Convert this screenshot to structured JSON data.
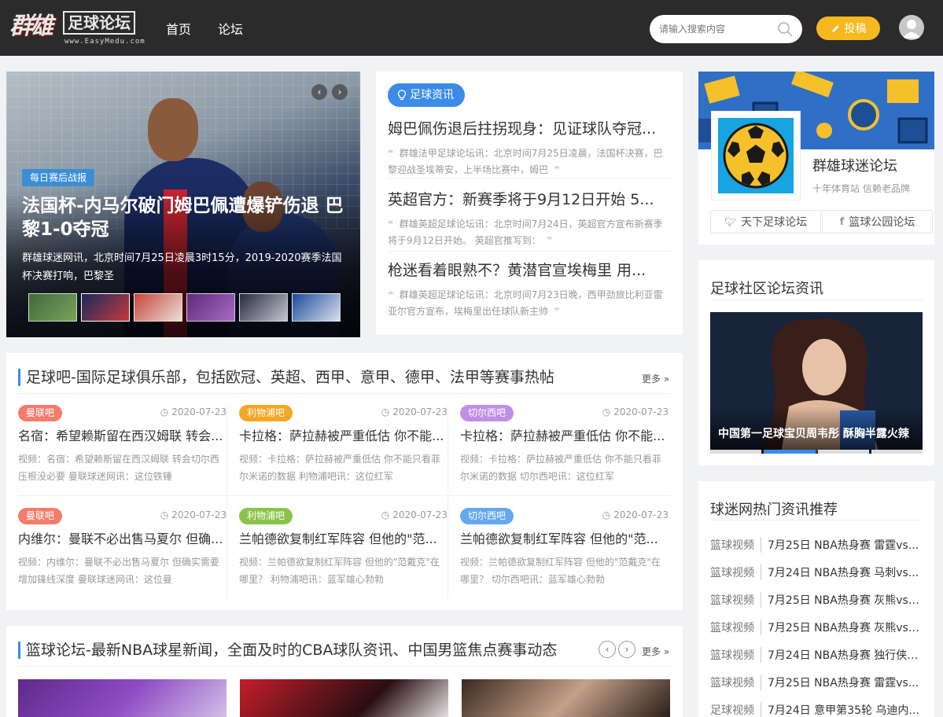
{
  "header": {
    "logo_main": "群雄",
    "logo_box": "足球论坛",
    "logo_url": "www.EasyMedu.com",
    "nav": [
      "首页",
      "论坛"
    ],
    "search_placeholder": "请输入搜索内容",
    "post_label": "投稿",
    "colors": {
      "bg": "#2b2b2b",
      "post_button": "#f6b81e"
    }
  },
  "slider": {
    "tag": "每日赛后战报",
    "title": "法国杯-内马尔破门姆巴佩遭爆铲伤退 巴黎1-0夺冠",
    "desc": "群雄球迷网讯，北京时间7月25日凌晨3时15分，2019-2020赛季法国杯决赛打响，巴黎圣",
    "prev_icon": "chevron-left-icon",
    "next_icon": "chevron-right-icon"
  },
  "news": {
    "tag": "足球资讯",
    "items": [
      {
        "title": "姆巴佩伤退后拄拐现身：见证球队夺冠...",
        "excerpt": "群雄法甲足球论坛讯：北京时间7月25日凌晨，法国杯决赛，巴黎迎战圣埃蒂安，上半场比赛中，姆巴"
      },
      {
        "title": "英超官方：新赛季将于9月12日开始 5...",
        "excerpt": "群雄英超足球论坛讯：北京时间7月24日，英超官方宣布新赛季将于9月12日开始。 英超官推写到："
      },
      {
        "title": "枪迷看着眼熟不？黄潜官宣埃梅里 用...",
        "excerpt": "群雄英超足球论坛讯：北京时间7月23日晚，西甲劲旅比利亚雷亚尔官方宣布，埃梅里出任球队新主帅"
      }
    ]
  },
  "football_section": {
    "title": "足球吧-国际足球俱乐部，包括欧冠、英超、西甲、意甲、德甲、法甲等赛事热帖",
    "more": "更多 »",
    "posts": [
      {
        "badge": "曼联吧",
        "badge_color": "#f47c6b",
        "date": "2020-07-23",
        "title": "名宿：希望赖斯留在西汉姆联 转会...",
        "excerpt": "视频：名宿：希望赖斯留在西汉姆联 转会切尔西压根没必要 曼联球迷网讯：这位铁锤"
      },
      {
        "badge": "利物浦吧",
        "badge_color": "#f5a623",
        "date": "2020-07-23",
        "title": "卡拉格：萨拉赫被严重低估 你不能...",
        "excerpt": "视频：卡拉格：萨拉赫被严重低估 你不能只看菲尔米诺的数据 利物浦吧讯：这位红军"
      },
      {
        "badge": "切尔西吧",
        "badge_color": "#c08ee3",
        "date": "2020-07-23",
        "title": "卡拉格：萨拉赫被严重低估 你不能...",
        "excerpt": "视频：卡拉格：萨拉赫被严重低估 你不能只看菲尔米诺的数据 切尔西吧讯：这位红军"
      },
      {
        "badge": "曼联吧",
        "badge_color": "#f47c6b",
        "date": "2020-07-23",
        "title": "内维尔：曼联不必出售马夏尔 但确...",
        "excerpt": "视频：内维尔：曼联不必出售马夏尔 但确实需要增加锋线深度 曼联球迷网讯：这位曼"
      },
      {
        "badge": "利物浦吧",
        "badge_color": "#8bc34a",
        "date": "2020-07-23",
        "title": "兰帕德欲复制红军阵容 但他的\"范...",
        "excerpt": "视频：兰帕德欲复制红军阵容 但他的\"范戴克\"在哪里？ 利物浦吧讯：蓝军雄心勃勃"
      },
      {
        "badge": "切尔西吧",
        "badge_color": "#64a8f0",
        "date": "2020-07-23",
        "title": "兰帕德欲复制红军阵容 但他的\"范...",
        "excerpt": "视频：兰帕德欲复制红军阵容 但他的\"范戴克\"在哪里？ 切尔西吧讯：蓝军雄心勃勃"
      }
    ]
  },
  "basketball_section": {
    "title": "篮球论坛-最新NBA球星新闻，全面及时的CBA球队资讯、中国男篮焦点赛事动态",
    "more": "更多 »"
  },
  "profile": {
    "name": "群雄球迷论坛",
    "sub": "十年体育站 信赖老品牌",
    "links": [
      "天下足球论坛",
      "篮球公园论坛"
    ]
  },
  "community": {
    "title": "足球社区论坛资讯",
    "feature_caption": "中国第一足球宝贝周韦彤 酥胸半露火辣"
  },
  "hot": {
    "title": "球迷网热门资讯推荐",
    "items": [
      {
        "cat": "篮球视频",
        "title": "7月25日 NBA热身赛 雷霆vs..."
      },
      {
        "cat": "篮球视频",
        "title": "7月24日 NBA热身赛 马刺vs..."
      },
      {
        "cat": "篮球视频",
        "title": "7月25日 NBA热身赛 灰熊vs7..."
      },
      {
        "cat": "篮球视频",
        "title": "7月25日 NBA热身赛 灰熊vs7..."
      },
      {
        "cat": "篮球视频",
        "title": "7月24日 NBA热身赛 独行侠v..."
      },
      {
        "cat": "篮球视频",
        "title": "7月25日 NBA热身赛 雷霆vs..."
      },
      {
        "cat": "足球视频",
        "title": "7月24日 意甲第35轮 乌迪内..."
      }
    ]
  }
}
